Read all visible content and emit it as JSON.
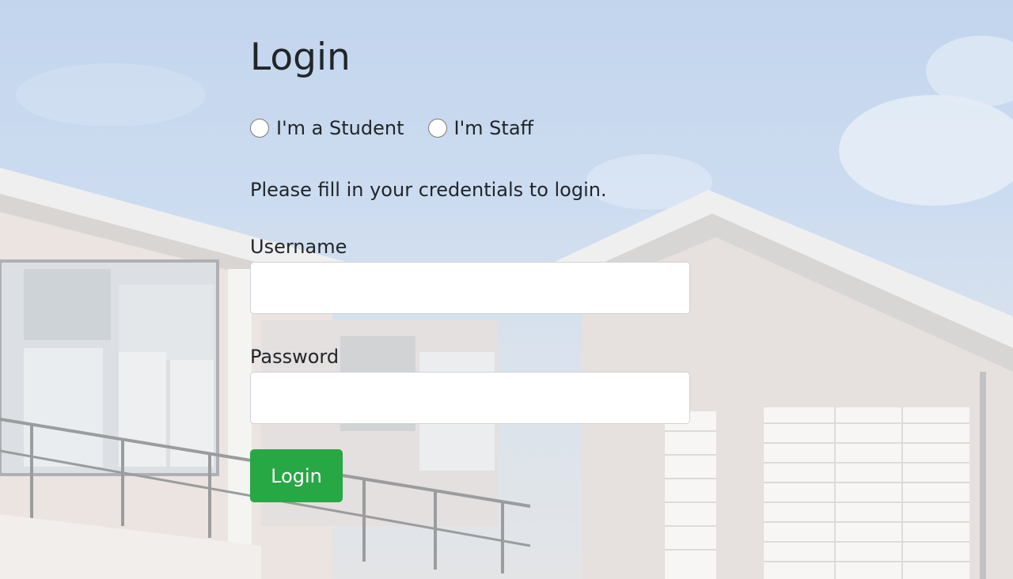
{
  "page": {
    "title": "Login",
    "instructions": "Please fill in your credentials to login."
  },
  "roles": {
    "student_label": "I'm a Student",
    "staff_label": "I'm Staff",
    "selected": "none"
  },
  "form": {
    "username_label": "Username",
    "username_value": "",
    "password_label": "Password",
    "password_value": "",
    "submit_label": "Login"
  },
  "colors": {
    "accent": "#28a745",
    "sky": "#b7cdea",
    "text": "#212529"
  },
  "background": {
    "description_icon": "campus-building-photo"
  }
}
